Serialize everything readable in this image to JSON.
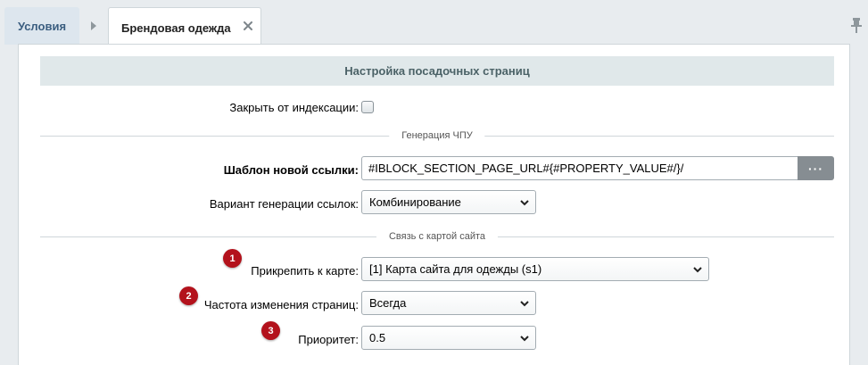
{
  "tabs": {
    "conditions_label": "Условия",
    "active_label": "Брендовая одежда"
  },
  "form": {
    "section_title": "Настройка посадочных страниц",
    "noindex_label": "Закрыть от индексации:",
    "noindex_checked": false,
    "seo_divider": "Генерация ЧПУ",
    "url_template_label": "Шаблон новой ссылки:",
    "url_template_value": "#IBLOCK_SECTION_PAGE_URL#{#PROPERTY_VALUE#/}/",
    "url_template_button": "···",
    "link_variant_label": "Вариант генерации ссылок:",
    "link_variant_value": "Комбинирование",
    "sitemap_divider": "Связь с картой сайта",
    "rows": [
      {
        "badge": "1",
        "label": "Прикрепить к карте:",
        "control": "[1] Карта сайта для одежды (s1)"
      },
      {
        "badge": "2",
        "label": "Частота изменения страниц:",
        "control": "Всегда"
      },
      {
        "badge": "3",
        "label": "Приоритет:",
        "control": "0.5"
      }
    ]
  },
  "icons": {
    "separator": "chevron-right-icon",
    "close": "close-icon",
    "pin": "pin-icon",
    "select_arrow": "chevron-down-icon"
  },
  "colors": {
    "tab_inactive_bg": "#dde6ee",
    "tab_inactive_text": "#3b5e80",
    "section_header_bg": "#e0e8ea",
    "badge": "#b3121c",
    "dots_button": "#868d92"
  }
}
